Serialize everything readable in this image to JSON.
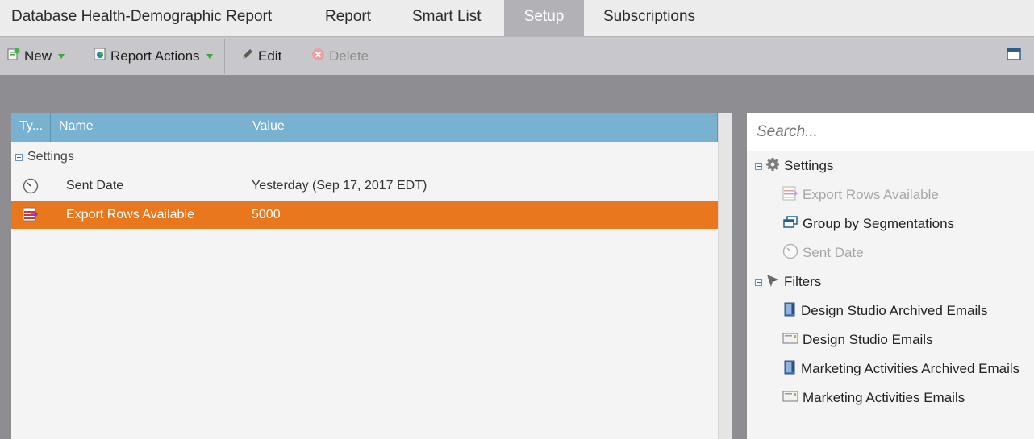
{
  "tabs": [
    {
      "label": "Database Health-Demographic Report",
      "active": false
    },
    {
      "label": "Report",
      "active": false
    },
    {
      "label": "Smart List",
      "active": false
    },
    {
      "label": "Setup",
      "active": true
    },
    {
      "label": "Subscriptions",
      "active": false
    }
  ],
  "toolbar": {
    "new_label": "New",
    "report_actions_label": "Report Actions",
    "edit_label": "Edit",
    "delete_label": "Delete"
  },
  "grid": {
    "columns": [
      "Ty...",
      "Name",
      "Value"
    ],
    "group_label": "Settings",
    "rows": [
      {
        "icon": "clock-icon",
        "name": "Sent Date",
        "value": "Yesterday (Sep 17, 2017 EDT)",
        "selected": false
      },
      {
        "icon": "export-rows-icon",
        "name": "Export Rows Available",
        "value": "5000",
        "selected": true
      }
    ]
  },
  "search": {
    "placeholder": "Search..."
  },
  "tree": {
    "settings_label": "Settings",
    "settings_items": [
      {
        "label": "Export Rows Available",
        "icon": "export-rows-icon",
        "disabled": true
      },
      {
        "label": "Group by Segmentations",
        "icon": "segmentation-icon",
        "disabled": false
      },
      {
        "label": "Sent Date",
        "icon": "clock-icon",
        "disabled": true
      }
    ],
    "filters_label": "Filters",
    "filter_items": [
      {
        "label": "Design Studio Archived Emails",
        "icon": "archived-email-icon"
      },
      {
        "label": "Design Studio Emails",
        "icon": "email-icon"
      },
      {
        "label": "Marketing Activities Archived Emails",
        "icon": "archived-email-icon"
      },
      {
        "label": "Marketing Activities Emails",
        "icon": "email-icon"
      }
    ]
  },
  "colors": {
    "selected_row": "#e8771e",
    "grid_header": "#78b2d0",
    "active_tab": "#b1b1b6"
  }
}
